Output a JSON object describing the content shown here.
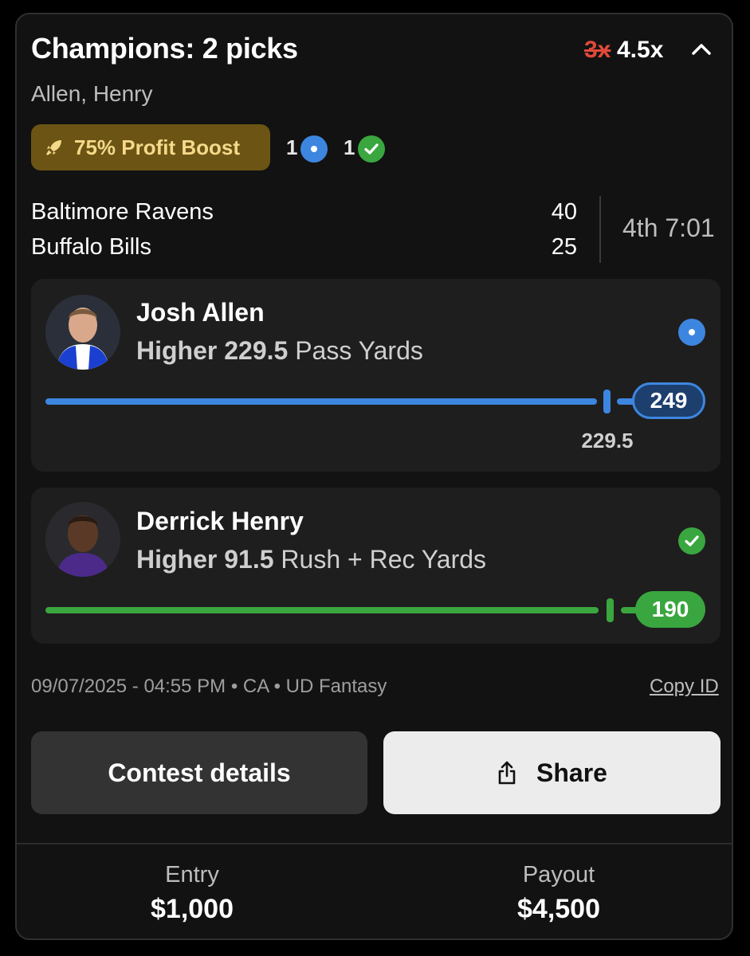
{
  "header": {
    "title": "Champions: 2 picks",
    "multiplier_old": "3x",
    "multiplier_new": "4.5x",
    "subtitle": "Allen, Henry"
  },
  "boost": {
    "label": "75% Profit Boost"
  },
  "counts": {
    "live": "1",
    "won": "1"
  },
  "game": {
    "team1": "Baltimore Ravens",
    "score1": "40",
    "team2": "Buffalo Bills",
    "score2": "25",
    "clock": "4th 7:01"
  },
  "picks": [
    {
      "player": "Josh Allen",
      "direction": "Higher",
      "line": "229.5",
      "stat": "Pass Yards",
      "current": "249",
      "line_label": "229.5",
      "status": "live",
      "color": "#3d86e0"
    },
    {
      "player": "Derrick Henry",
      "direction": "Higher",
      "line": "91.5",
      "stat": "Rush + Rec Yards",
      "current": "190",
      "status": "won",
      "color": "#3aa63f"
    }
  ],
  "meta": {
    "text": "09/07/2025 - 04:55 PM • CA • UD Fantasy",
    "copy_id": "Copy ID"
  },
  "buttons": {
    "contest": "Contest details",
    "share": "Share"
  },
  "footer": {
    "entry_label": "Entry",
    "entry_value": "$1,000",
    "payout_label": "Payout",
    "payout_value": "$4,500"
  }
}
